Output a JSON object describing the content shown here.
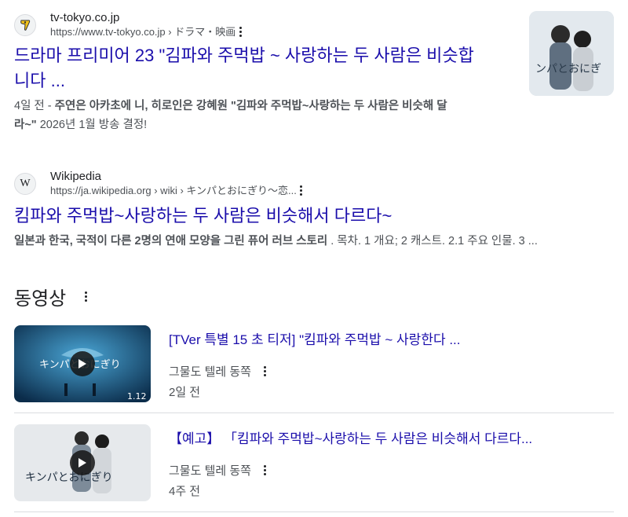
{
  "results": [
    {
      "site_name": "tv-tokyo.co.jp",
      "url": "https://www.tv-tokyo.co.jp › ドラマ・映画",
      "title_line1": "드라마 프리미어 23 \"김파와 주먹밥 ~ 사랑하는 두 사람은 비슷합",
      "title_line2": "니다 ...",
      "snippet_date": "4일 전",
      "snippet_sep": " - ",
      "snippet_bold1": "주연은 아카초에 니, 히로인은 강혜원 \"김파와 주먹밥~사랑하는 두 사람은 비슷해 달",
      "snippet_bold2": "라~\"",
      "snippet_rest": " 2026년 1월 방송 결정!"
    },
    {
      "site_name": "Wikipedia",
      "url": "https://ja.wikipedia.org › wiki › キンパとおにぎり～恋...",
      "title": "킴파와 주먹밥~사랑하는 두 사람은 비슷해서 다르다~",
      "snippet_bold": "일본과 한국, 국적이 다른 2명의 연애 모양을 그린 퓨어 러브 스토리",
      "snippet_rest": " . 목차. 1 개요; 2 캐스트. 2.1 주요 인물. 3 ..."
    }
  ],
  "videos_section": {
    "title": "동영상",
    "items": [
      {
        "title": "[TVer 특별 15 초 티저] \"킴파와 주먹밥 ~ 사랑한다 ...",
        "channel": "그물도 텔레 동쪽",
        "age": "2일 전",
        "thumb_text": "キンパとおにぎり",
        "thumb_corner": "1.12"
      },
      {
        "title": "【예고】 「킴파와 주먹밥~사랑하는 두 사람은 비슷해서 다르다...",
        "channel": "그물도 텔레 동쪽",
        "age": "4주 전",
        "thumb_text": "キンパとおにぎり"
      }
    ]
  },
  "icons": {
    "tvtokyo": "tv-tokyo-favicon-icon",
    "wikipedia": "wikipedia-favicon-icon",
    "more": "more-vert-icon",
    "play": "play-icon"
  },
  "colors": {
    "link": "#1a0dab",
    "text": "#202124",
    "muted": "#4d5156",
    "divider": "#dadce0"
  }
}
